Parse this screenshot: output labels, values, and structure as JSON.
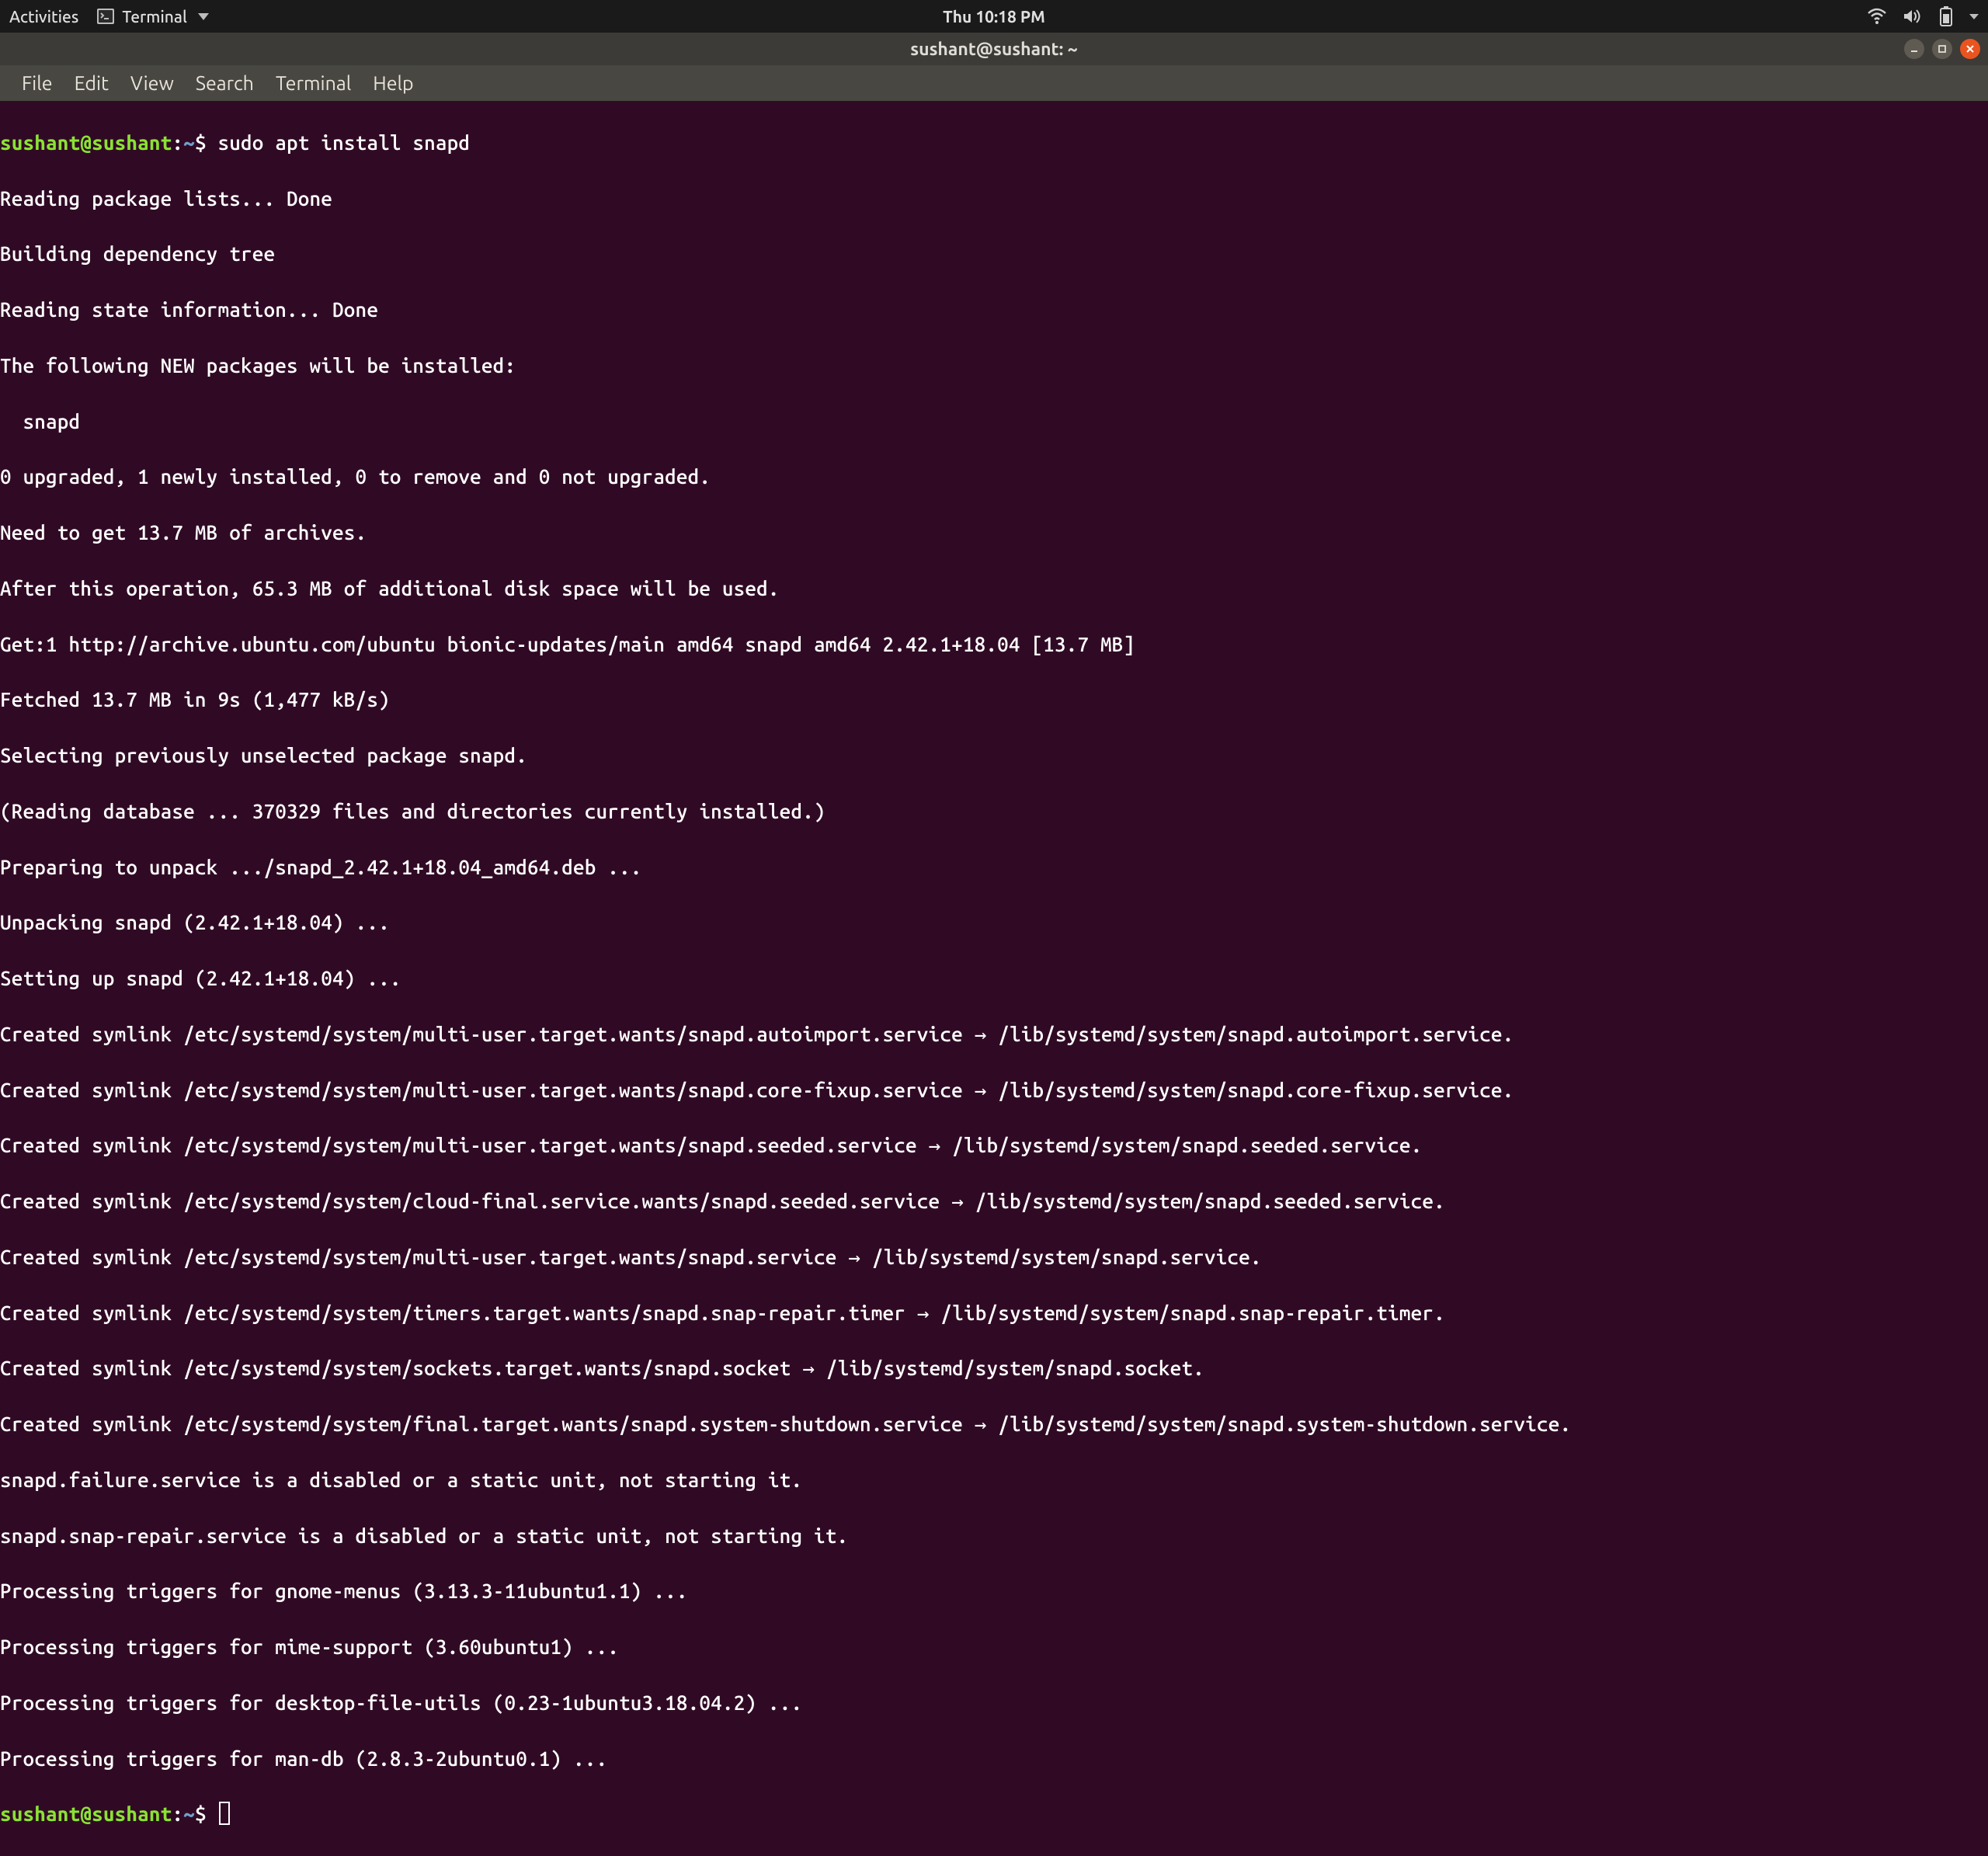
{
  "topbar": {
    "activities": "Activities",
    "app_name": "Terminal",
    "clock": "Thu 10:18 PM"
  },
  "titlebar": {
    "title": "sushant@sushant: ~"
  },
  "menubar": {
    "file": "File",
    "edit": "Edit",
    "view": "View",
    "search": "Search",
    "terminal": "Terminal",
    "help": "Help"
  },
  "terminal": {
    "prompt_user": "sushant@sushant",
    "prompt_sep": ":",
    "prompt_path": "~",
    "prompt_char": "$",
    "command": "sudo apt install snapd",
    "output_lines": [
      "Reading package lists... Done",
      "Building dependency tree",
      "Reading state information... Done",
      "The following NEW packages will be installed:",
      "  snapd",
      "0 upgraded, 1 newly installed, 0 to remove and 0 not upgraded.",
      "Need to get 13.7 MB of archives.",
      "After this operation, 65.3 MB of additional disk space will be used.",
      "Get:1 http://archive.ubuntu.com/ubuntu bionic-updates/main amd64 snapd amd64 2.42.1+18.04 [13.7 MB]",
      "Fetched 13.7 MB in 9s (1,477 kB/s)",
      "Selecting previously unselected package snapd.",
      "(Reading database ... 370329 files and directories currently installed.)",
      "Preparing to unpack .../snapd_2.42.1+18.04_amd64.deb ...",
      "Unpacking snapd (2.42.1+18.04) ...",
      "Setting up snapd (2.42.1+18.04) ...",
      "Created symlink /etc/systemd/system/multi-user.target.wants/snapd.autoimport.service → /lib/systemd/system/snapd.autoimport.service.",
      "Created symlink /etc/systemd/system/multi-user.target.wants/snapd.core-fixup.service → /lib/systemd/system/snapd.core-fixup.service.",
      "Created symlink /etc/systemd/system/multi-user.target.wants/snapd.seeded.service → /lib/systemd/system/snapd.seeded.service.",
      "Created symlink /etc/systemd/system/cloud-final.service.wants/snapd.seeded.service → /lib/systemd/system/snapd.seeded.service.",
      "Created symlink /etc/systemd/system/multi-user.target.wants/snapd.service → /lib/systemd/system/snapd.service.",
      "Created symlink /etc/systemd/system/timers.target.wants/snapd.snap-repair.timer → /lib/systemd/system/snapd.snap-repair.timer.",
      "Created symlink /etc/systemd/system/sockets.target.wants/snapd.socket → /lib/systemd/system/snapd.socket.",
      "Created symlink /etc/systemd/system/final.target.wants/snapd.system-shutdown.service → /lib/systemd/system/snapd.system-shutdown.service.",
      "snapd.failure.service is a disabled or a static unit, not starting it.",
      "snapd.snap-repair.service is a disabled or a static unit, not starting it.",
      "Processing triggers for gnome-menus (3.13.3-11ubuntu1.1) ...",
      "Processing triggers for mime-support (3.60ubuntu1) ...",
      "Processing triggers for desktop-file-utils (0.23-1ubuntu3.18.04.2) ...",
      "Processing triggers for man-db (2.8.3-2ubuntu0.1) ..."
    ]
  }
}
